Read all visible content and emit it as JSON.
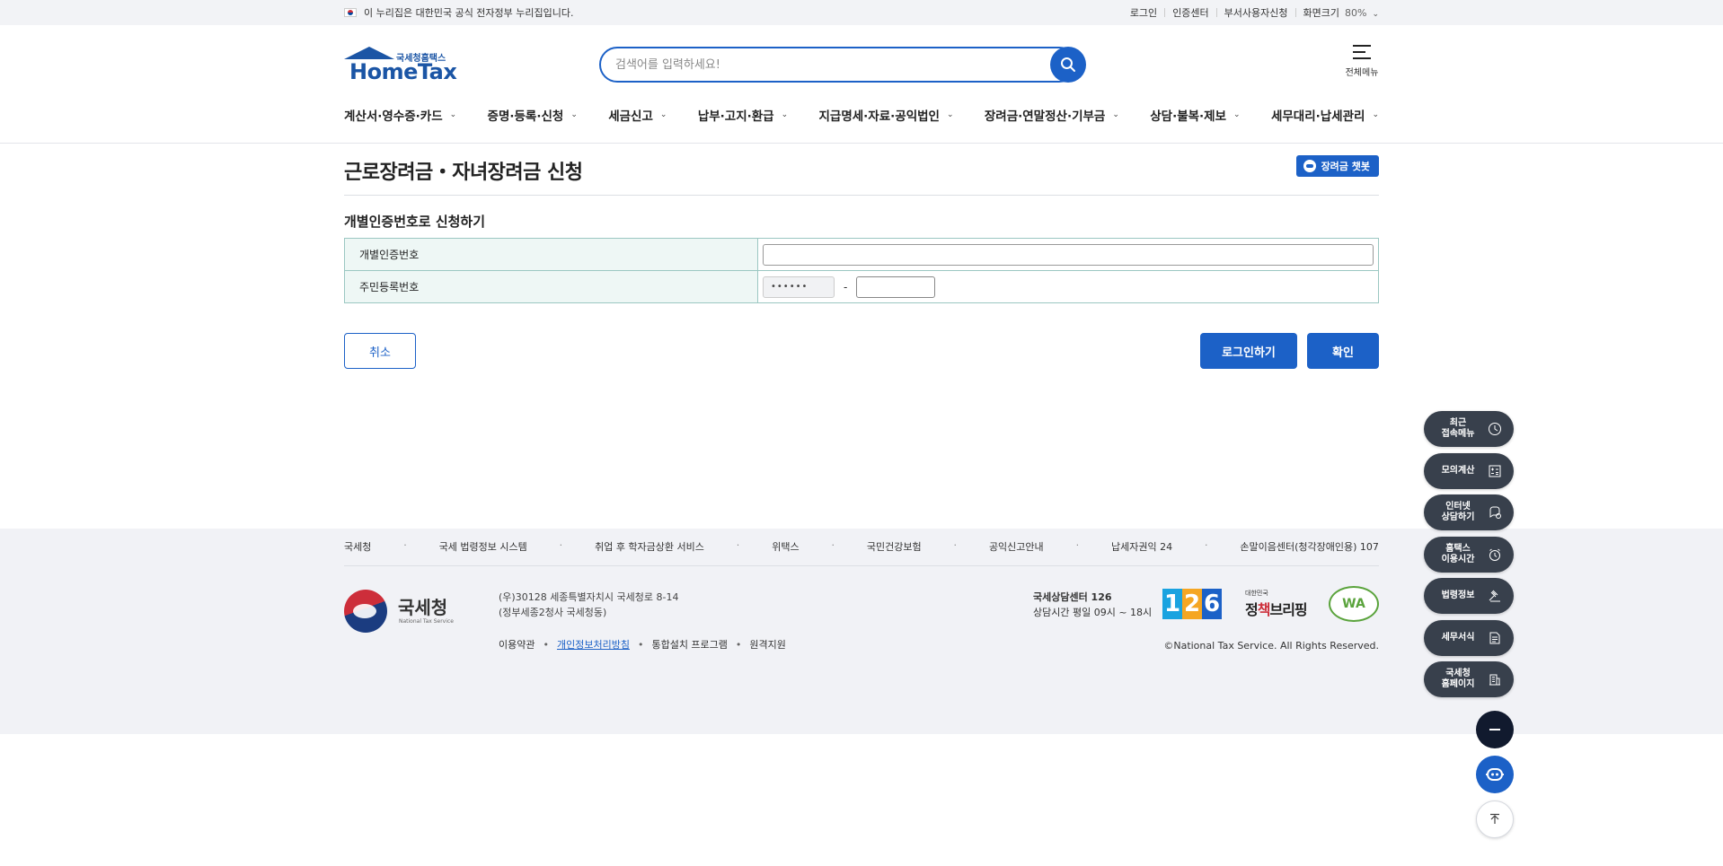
{
  "topbar": {
    "gov_notice": "이 누리집은 대한민국 공식 전자정부 누리집입니다.",
    "links": [
      "로그인",
      "인증센터",
      "부서사용자신청"
    ],
    "zoom_label": "화면크기",
    "zoom_value": "80%"
  },
  "header": {
    "logo_sub": "국세청홈택스",
    "logo_main": "HomeTax",
    "search_placeholder": "검색어를 입력하세요!",
    "all_menu": "전체메뉴",
    "nav": [
      "계산서·영수증·카드",
      "증명·등록·신청",
      "세금신고",
      "납부·고지·환급",
      "지급명세·자료·공익법인",
      "장려금·연말정산·기부금",
      "상담·불복·제보",
      "세무대리·납세관리"
    ]
  },
  "main": {
    "title": "근로장려금・자녀장려금 신청",
    "chatbot_label": "장려금 챗봇",
    "section_title": "개별인증번호로 신청하기",
    "rows": {
      "auth_label": "개별인증번호",
      "rrn_label": "주민등록번호",
      "rrn_front": "••••••",
      "rrn_dash": "-"
    },
    "buttons": {
      "cancel": "취소",
      "login": "로그인하기",
      "confirm": "확인"
    }
  },
  "footer": {
    "links": [
      "국세청",
      "국세 법령정보 시스템",
      "취업 후 학자금상환 서비스",
      "위택스",
      "국민건강보험",
      "공익신고안내",
      "납세자권익 24",
      "손말이음센터(청각장애인용) 107"
    ],
    "link_sep": "·",
    "nts_kor": "국세청",
    "nts_eng": "National Tax Service",
    "address_line1": "(우)30128 세종특별자치시 국세청로 8-14",
    "address_line2": "(정부세종2청사 국세청동)",
    "policy": [
      "이용약관",
      "개인정보처리방침",
      "통합설치 프로그램",
      "원격지원"
    ],
    "policy_sep": "•",
    "center_name": "국세상담센터 126",
    "center_hours": "상담시간 평일 09시 ~ 18시",
    "badge_126": [
      "1",
      "2",
      "6"
    ],
    "briefing_small": "대한민국",
    "briefing_pre": "정",
    "briefing_red": "책",
    "briefing_post": "브리핑",
    "wa_mark": "WA",
    "copyright": "©National Tax Service. All Rights Reserved."
  },
  "quick_menu": [
    {
      "label": "최근\n접속메뉴",
      "icon": "clock-icon"
    },
    {
      "label": "모의계산",
      "icon": "calculator-icon"
    },
    {
      "label": "인터넷\n상담하기",
      "icon": "chat-icon"
    },
    {
      "label": "홈택스\n이용시간",
      "icon": "alarm-icon"
    },
    {
      "label": "법령정보",
      "icon": "gavel-icon"
    },
    {
      "label": "세무서식",
      "icon": "document-icon"
    },
    {
      "label": "국세청\n홈페이지",
      "icon": "building-icon"
    }
  ],
  "colors": {
    "primary": "#1c61c7",
    "brand": "#1b55a5",
    "table_border": "#9bc7c2",
    "table_head_bg": "#eef7f5",
    "quick_bg": "#38404c"
  }
}
